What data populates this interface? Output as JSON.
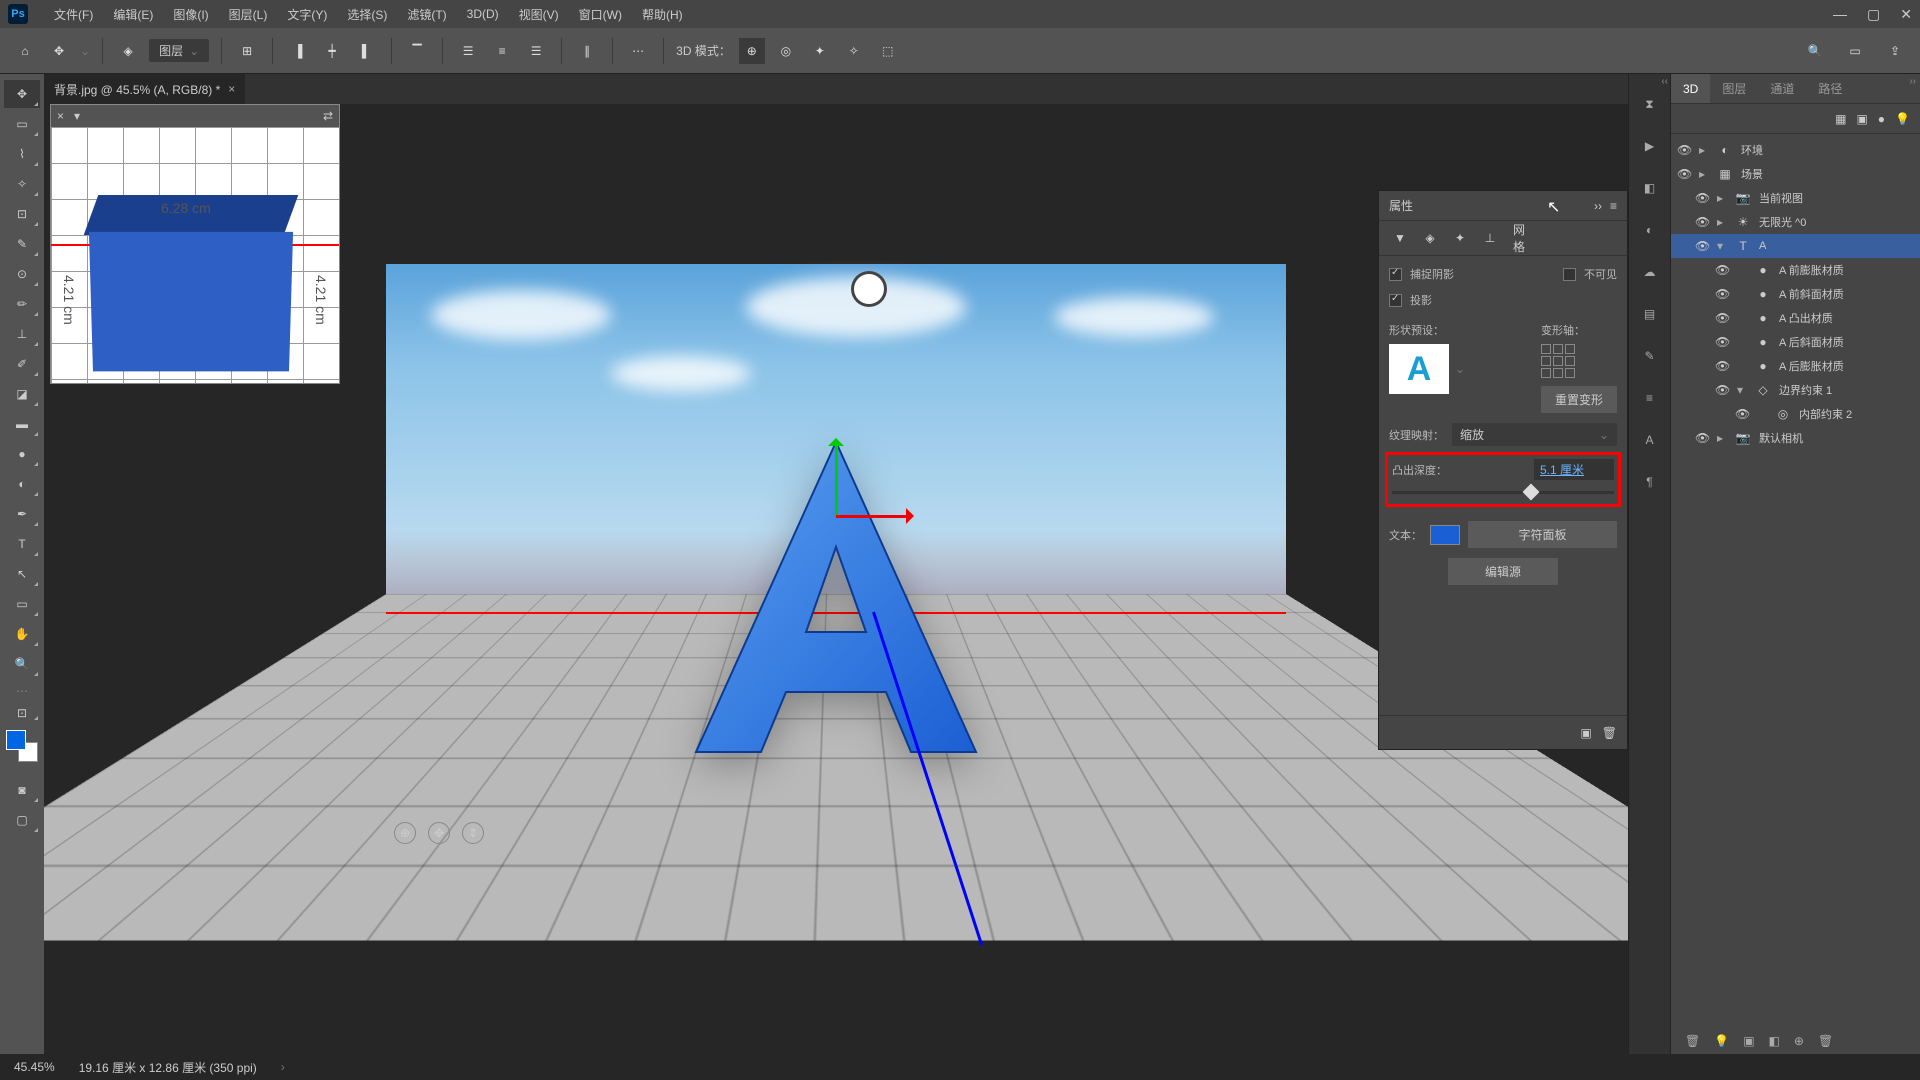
{
  "menubar": {
    "items": [
      "文件(F)",
      "编辑(E)",
      "图像(I)",
      "图层(L)",
      "文字(Y)",
      "选择(S)",
      "滤镜(T)",
      "3D(D)",
      "视图(V)",
      "窗口(W)",
      "帮助(H)"
    ]
  },
  "opt": {
    "layer_dd": "图层",
    "mode_label": "3D 模式："
  },
  "tab": {
    "title": "背景.jpg @ 45.5% (A, RGB/8) *"
  },
  "secview": {
    "dim_w": "6.28 cm",
    "dim_h": "4.21 cm"
  },
  "prop": {
    "title": "属性",
    "mesh_tab": "网格",
    "catch_shadow": "捕捉阴影",
    "invisible": "不可见",
    "cast_shadow": "投影",
    "shape_preset": "形状预设：",
    "deform_axis": "变形轴：",
    "reset_deform": "重置变形",
    "tx_map": "纹理映射：",
    "tx_map_val": "缩放",
    "extrude": "凸出深度：",
    "extrude_val": "5.1 厘米",
    "text": "文本：",
    "char_panel": "字符面板",
    "edit_src": "编辑源"
  },
  "rpanel": {
    "tabs": [
      "3D",
      "图层",
      "通道",
      "路径"
    ],
    "tree": [
      {
        "label": "环境",
        "icon": "◐",
        "i": 0
      },
      {
        "label": "场景",
        "icon": "▦",
        "i": 0
      },
      {
        "label": "当前视图",
        "icon": "▪",
        "i": 1,
        "cam": true
      },
      {
        "label": "无限光 ^0",
        "icon": "☀",
        "i": 1
      },
      {
        "label": "A",
        "icon": "T",
        "i": 1,
        "sel": true,
        "exp": true
      },
      {
        "label": "A 前膨胀材质",
        "icon": "●",
        "i": 2
      },
      {
        "label": "A 前斜面材质",
        "icon": "●",
        "i": 2
      },
      {
        "label": "A 凸出材质",
        "icon": "●",
        "i": 2
      },
      {
        "label": "A 后斜面材质",
        "icon": "●",
        "i": 2
      },
      {
        "label": "A 后膨胀材质",
        "icon": "●",
        "i": 2
      },
      {
        "label": "边界约束 1",
        "icon": "◇",
        "i": 2,
        "exp": true
      },
      {
        "label": "内部约束 2",
        "icon": "◎",
        "i": 3
      },
      {
        "label": "默认相机",
        "icon": "▪",
        "i": 1,
        "cam": true
      }
    ]
  },
  "status": {
    "zoom": "45.45%",
    "dims": "19.16 厘米 x 12.86 厘米 (350 ppi)"
  }
}
